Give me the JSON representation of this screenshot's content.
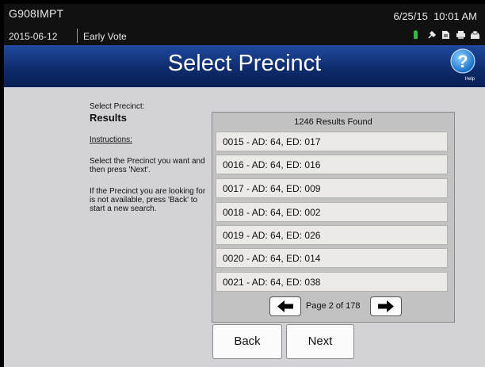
{
  "header": {
    "device_id": "G908IMPT",
    "date": "2015-06-12",
    "mode": "Early Vote",
    "datetime": "6/25/15  10:01 AM",
    "status_icons": [
      "battery-icon",
      "plug-icon",
      "document-icon",
      "printer-icon",
      "ballot-box-icon"
    ]
  },
  "titlebar": {
    "title": "Select Precinct",
    "help_label": "Help"
  },
  "left": {
    "select_label": "Select Precinct:",
    "results_label": "Results",
    "instructions_label": "Instructions:",
    "instruction_1": "Select the Precinct you want and then press 'Next'.",
    "instruction_2": "If the Precinct you are looking for is not available, press 'Back' to start a new search."
  },
  "results": {
    "count_label": "1246 Results Found",
    "items": [
      "0015 - AD: 64, ED: 017",
      "0016 - AD: 64, ED: 016",
      "0017 - AD: 64, ED: 009",
      "0018 - AD: 64, ED: 002",
      "0019 - AD: 64, ED: 026",
      "0020 - AD: 64, ED: 014",
      "0021 - AD: 64, ED: 038"
    ],
    "page_label": "Page 2 of 178"
  },
  "buttons": {
    "back": "Back",
    "next": "Next"
  },
  "colors": {
    "title_bar": "#0e2a6a",
    "content_bg": "#d3d3d7",
    "row_bg": "#eceae6",
    "battery": "#2fbf3a"
  }
}
